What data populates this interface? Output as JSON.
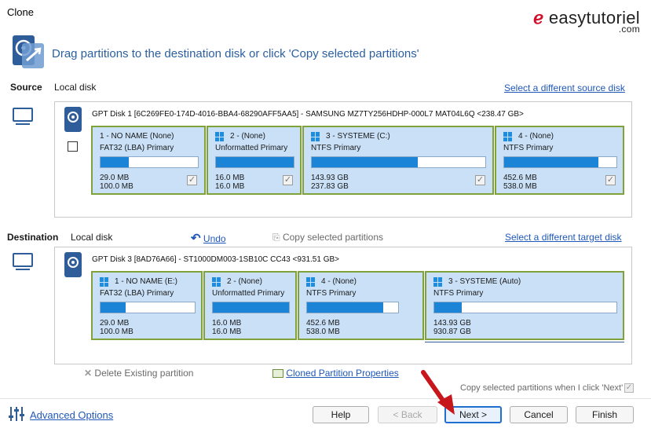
{
  "window": {
    "title": "Clone"
  },
  "logo": {
    "text": "easytutoriel",
    "suffix": ".com"
  },
  "header": {
    "instruction": "Drag partitions to the destination disk or click 'Copy selected partitions'"
  },
  "source": {
    "label": "Source",
    "disk_type": "Local disk",
    "select_link": "Select a different source disk",
    "disk_line": "GPT Disk 1 [6C269FE0-174D-4016-BBA4-68290AFF5AA5] - SAMSUNG MZ7TY256HDHP-000L7 MAT04L6Q  <238.47 GB>",
    "partitions": [
      {
        "name": "1 - NO NAME (None)",
        "type": "FAT32 (LBA) Primary",
        "used": "29.0 MB",
        "total": "100.0 MB",
        "fill": 0.29,
        "checked": true,
        "win_icon": false
      },
      {
        "name": "2 - (None)",
        "type": "Unformatted Primary",
        "used": "16.0 MB",
        "total": "16.0 MB",
        "fill": 1.0,
        "checked": true,
        "win_icon": true
      },
      {
        "name": "3 - SYSTEME (C:)",
        "type": "NTFS Primary",
        "used": "143.93 GB",
        "total": "237.83 GB",
        "fill": 0.61,
        "checked": true,
        "win_icon": true
      },
      {
        "name": "4 - (None)",
        "type": "NTFS Primary",
        "used": "452.6 MB",
        "total": "538.0 MB",
        "fill": 0.84,
        "checked": true,
        "win_icon": true
      }
    ]
  },
  "destination": {
    "label": "Destination",
    "disk_type": "Local disk",
    "undo": "Undo",
    "copy_selected": "Copy selected partitions",
    "select_link": "Select a different target disk",
    "disk_line": "GPT Disk 3 [8AD76A66] - ST1000DM003-1SB10C CC43  <931.51 GB>",
    "partitions": [
      {
        "name": "1 - NO NAME (E:)",
        "type": "FAT32 (LBA) Primary",
        "used": "29.0 MB",
        "total": "100.0 MB",
        "fill": 0.27
      },
      {
        "name": "2 - (None)",
        "type": "Unformatted Primary",
        "used": "16.0 MB",
        "total": "16.0 MB",
        "fill": 1.0
      },
      {
        "name": "4 - (None)",
        "type": "NTFS Primary",
        "used": "452.6 MB",
        "total": "538.0 MB",
        "fill": 0.84
      },
      {
        "name": "3 - SYSTEME (Auto)",
        "type": "NTFS Primary",
        "used": "143.93 GB",
        "total": "930.87 GB",
        "fill": 0.15
      }
    ]
  },
  "actions": {
    "delete": "Delete Existing partition",
    "properties": "Cloned Partition Properties",
    "copy_on_next": "Copy selected partitions when I click 'Next'"
  },
  "footer": {
    "advanced": "Advanced Options",
    "help": "Help",
    "back": "< Back",
    "next": "Next >",
    "cancel": "Cancel",
    "finish": "Finish"
  },
  "colors": {
    "accent": "#1f58b8",
    "partition_bg": "#c9e0f7",
    "bar_fill": "#1c84d6",
    "selected_outline": "#7fa33a",
    "pointer_arrow": "#c8161d"
  }
}
